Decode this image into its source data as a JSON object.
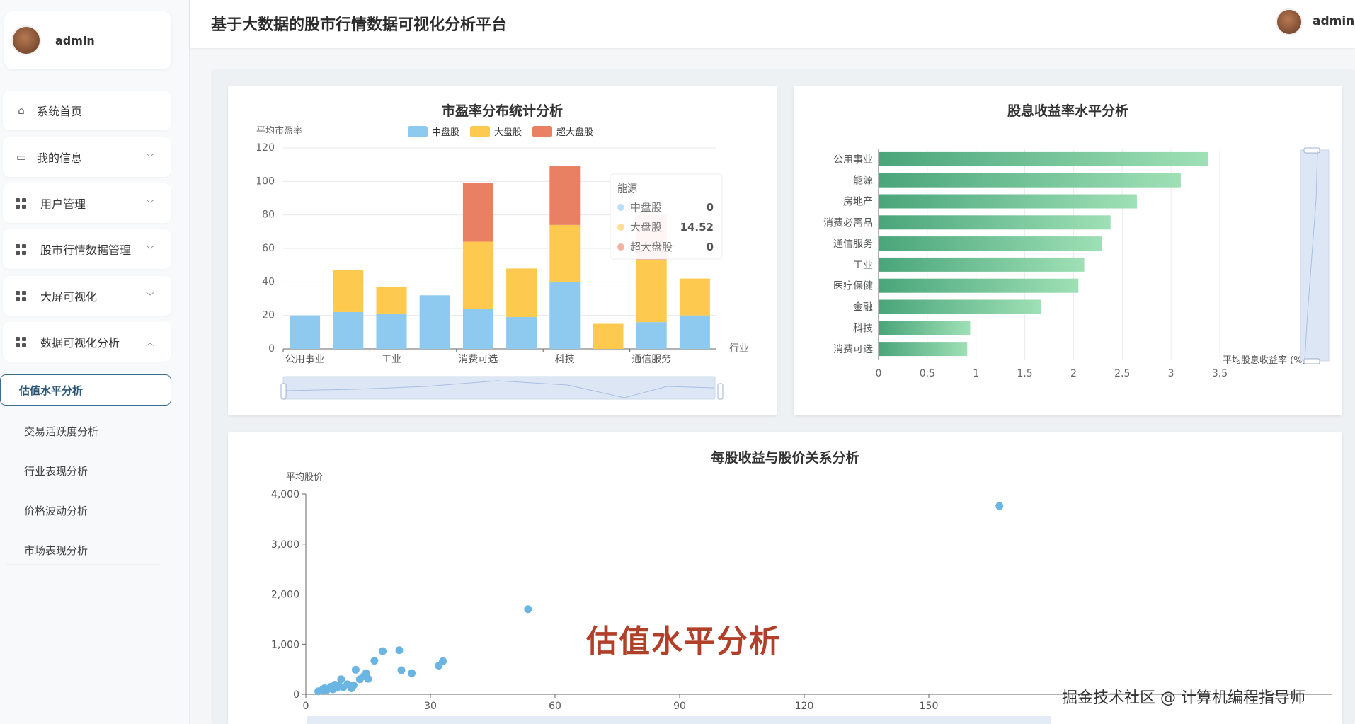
{
  "header": {
    "title": "基于大数据的股市行情数据可视化分析平台",
    "user": "admin"
  },
  "sidebar": {
    "user": "admin",
    "menu": [
      {
        "label": "系统首页",
        "icon": "home-icon"
      },
      {
        "label": "我的信息",
        "icon": "card-icon"
      },
      {
        "label": "用户管理",
        "icon": "grid-icon"
      },
      {
        "label": "股市行情数据管理",
        "icon": "grid-icon"
      },
      {
        "label": "大屏可视化",
        "icon": "grid-icon"
      },
      {
        "label": "数据可视化分析",
        "icon": "grid-icon"
      }
    ],
    "submenu": [
      "估值水平分析",
      "交易活跃度分析",
      "行业表现分析",
      "价格波动分析",
      "市场表现分析"
    ]
  },
  "overlay_label": "估值水平分析",
  "watermark": "掘金技术社区 @ 计算机编程指导师",
  "colors": {
    "mid": "#8ec9f0",
    "large": "#fdc94f",
    "xlarge": "#e98064",
    "bar_green_start": "#4aa57a",
    "bar_green_end": "#9fe0b6",
    "scatter": "#6bb5e2"
  },
  "chart_data": [
    {
      "type": "bar",
      "title": "市盈率分布统计分析",
      "ylabel": "平均市盈率",
      "xlabel": "行业",
      "ylim": [
        0,
        120
      ],
      "yticks": [
        "0",
        "20",
        "40",
        "60",
        "80",
        "100",
        "120"
      ],
      "categories": [
        "公用事业",
        "",
        "工业",
        "",
        "消费可选",
        "",
        "科技",
        "",
        "通信服务",
        ""
      ],
      "series": [
        {
          "name": "中盘股",
          "values": [
            20,
            22,
            21,
            32,
            24,
            19,
            40,
            0,
            16,
            20
          ]
        },
        {
          "name": "大盘股",
          "values": [
            0,
            25,
            16,
            0,
            40,
            29,
            34,
            15,
            37,
            22
          ]
        },
        {
          "name": "超大盘股",
          "values": [
            0,
            0,
            0,
            0,
            35,
            0,
            35,
            0,
            27,
            0
          ]
        }
      ],
      "legend_position": "top",
      "tooltip": {
        "title": "能源",
        "rows": [
          {
            "name": "中盘股",
            "value": "0"
          },
          {
            "name": "大盘股",
            "value": "14.52"
          },
          {
            "name": "超大盘股",
            "value": "0"
          }
        ]
      }
    },
    {
      "type": "bar",
      "orientation": "horizontal",
      "title": "股息收益率水平分析",
      "xlabel": "平均股息收益率 (%)",
      "xlim": [
        0,
        3.5
      ],
      "xticks": [
        "0",
        "0.5",
        "1",
        "1.5",
        "2",
        "2.5",
        "3",
        "3.5"
      ],
      "categories": [
        "公用事业",
        "能源",
        "房地产",
        "消费必需品",
        "通信服务",
        "工业",
        "医疗保健",
        "金融",
        "科技",
        "消费可选"
      ],
      "values": [
        3.38,
        3.1,
        2.65,
        2.38,
        2.29,
        2.11,
        2.05,
        1.67,
        0.94,
        0.91
      ]
    },
    {
      "type": "scatter",
      "title": "每股收益与股价关系分析",
      "ylabel": "平均股价",
      "xlim": [
        0,
        180
      ],
      "ylim": [
        0,
        4000
      ],
      "xticks": [
        "0",
        "30",
        "60",
        "90",
        "120",
        "150"
      ],
      "yticks": [
        "0",
        "1,000",
        "2,000",
        "3,000",
        "4,000"
      ],
      "points": [
        [
          3,
          60
        ],
        [
          4,
          90
        ],
        [
          4.5,
          120
        ],
        [
          5,
          80
        ],
        [
          6,
          150
        ],
        [
          6.5,
          100
        ],
        [
          7,
          190
        ],
        [
          7.5,
          130
        ],
        [
          8,
          170
        ],
        [
          8.5,
          300
        ],
        [
          9,
          140
        ],
        [
          10,
          200
        ],
        [
          11,
          120
        ],
        [
          11.5,
          180
        ],
        [
          12,
          490
        ],
        [
          13,
          300
        ],
        [
          14,
          360
        ],
        [
          14.5,
          420
        ],
        [
          15,
          310
        ],
        [
          16.5,
          670
        ],
        [
          18.5,
          860
        ],
        [
          22.5,
          880
        ],
        [
          23,
          480
        ],
        [
          25.5,
          420
        ],
        [
          32,
          570
        ],
        [
          33,
          660
        ],
        [
          53.5,
          1700
        ],
        [
          167,
          3760
        ]
      ]
    }
  ]
}
